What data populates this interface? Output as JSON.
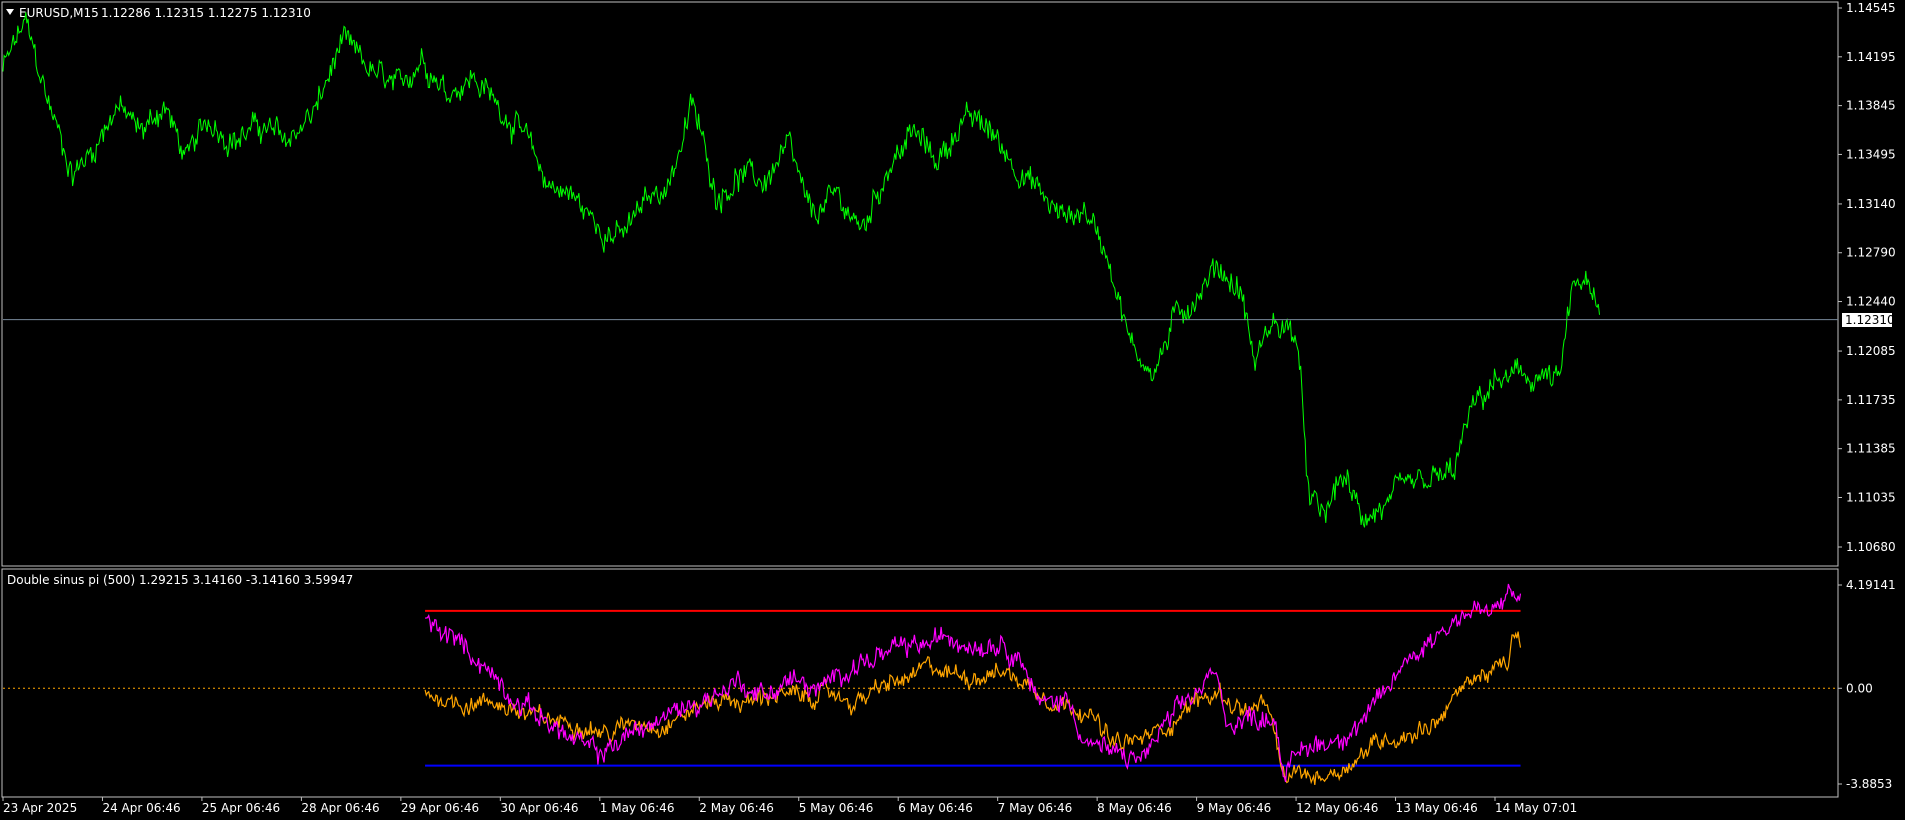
{
  "colors": {
    "background": "#000000",
    "frame": "#c0c0c0",
    "price_line": "#00ff00",
    "bid_line": "#778899",
    "bid_label_bg": "#ffffff",
    "bid_label_text": "#000000",
    "indicator_magenta": "#ff00ff",
    "indicator_orange": "#ffa500",
    "upper_level": "#ff0000",
    "lower_level": "#0000ff",
    "zero_level": "#ffa500"
  },
  "main_chart": {
    "title": "EURUSD,M15",
    "ohlc": "1.12286 1.12315 1.12275 1.12310",
    "menu_icon": "triangle-down-icon",
    "bid_price": "1.12310",
    "price_labels": [
      "1.14545",
      "1.14195",
      "1.13845",
      "1.13495",
      "1.13140",
      "1.12790",
      "1.12440",
      "1.12085",
      "1.11735",
      "1.11385",
      "1.11035",
      "1.10680"
    ],
    "price_anchors": [
      {
        "t": 0,
        "v": 1.141
      },
      {
        "t": 0.012,
        "v": 1.1445
      },
      {
        "t": 0.024,
        "v": 1.139
      },
      {
        "t": 0.038,
        "v": 1.1335
      },
      {
        "t": 0.05,
        "v": 1.1355
      },
      {
        "t": 0.062,
        "v": 1.1385
      },
      {
        "t": 0.075,
        "v": 1.1365
      },
      {
        "t": 0.088,
        "v": 1.1385
      },
      {
        "t": 0.1,
        "v": 1.1345
      },
      {
        "t": 0.112,
        "v": 1.1375
      },
      {
        "t": 0.126,
        "v": 1.136
      },
      {
        "t": 0.14,
        "v": 1.137
      },
      {
        "t": 0.155,
        "v": 1.136
      },
      {
        "t": 0.17,
        "v": 1.138
      },
      {
        "t": 0.185,
        "v": 1.143
      },
      {
        "t": 0.2,
        "v": 1.141
      },
      {
        "t": 0.215,
        "v": 1.1395
      },
      {
        "t": 0.228,
        "v": 1.142
      },
      {
        "t": 0.242,
        "v": 1.1395
      },
      {
        "t": 0.256,
        "v": 1.1405
      },
      {
        "t": 0.27,
        "v": 1.1385
      },
      {
        "t": 0.283,
        "v": 1.1365
      },
      {
        "t": 0.296,
        "v": 1.133
      },
      {
        "t": 0.31,
        "v": 1.132
      },
      {
        "t": 0.323,
        "v": 1.13
      },
      {
        "t": 0.337,
        "v": 1.129
      },
      {
        "t": 0.35,
        "v": 1.1315
      },
      {
        "t": 0.363,
        "v": 1.133
      },
      {
        "t": 0.376,
        "v": 1.1385
      },
      {
        "t": 0.389,
        "v": 1.132
      },
      {
        "t": 0.402,
        "v": 1.1335
      },
      {
        "t": 0.415,
        "v": 1.133
      },
      {
        "t": 0.428,
        "v": 1.1355
      },
      {
        "t": 0.44,
        "v": 1.1305
      },
      {
        "t": 0.455,
        "v": 1.132
      },
      {
        "t": 0.468,
        "v": 1.1295
      },
      {
        "t": 0.482,
        "v": 1.134
      },
      {
        "t": 0.496,
        "v": 1.1365
      },
      {
        "t": 0.51,
        "v": 1.1345
      },
      {
        "t": 0.523,
        "v": 1.1375
      },
      {
        "t": 0.536,
        "v": 1.137
      },
      {
        "t": 0.55,
        "v": 1.1345
      },
      {
        "t": 0.563,
        "v": 1.1325
      },
      {
        "t": 0.576,
        "v": 1.1305
      },
      {
        "t": 0.59,
        "v": 1.131
      },
      {
        "t": 0.603,
        "v": 1.1275
      },
      {
        "t": 0.615,
        "v": 1.121
      },
      {
        "t": 0.628,
        "v": 1.1195
      },
      {
        "t": 0.64,
        "v": 1.1235
      },
      {
        "t": 0.652,
        "v": 1.125
      },
      {
        "t": 0.662,
        "v": 1.127
      },
      {
        "t": 0.675,
        "v": 1.125
      },
      {
        "t": 0.682,
        "v": 1.12
      },
      {
        "t": 0.692,
        "v": 1.123
      },
      {
        "t": 0.705,
        "v": 1.122
      },
      {
        "t": 0.712,
        "v": 1.11
      },
      {
        "t": 0.72,
        "v": 1.109
      },
      {
        "t": 0.73,
        "v": 1.112
      },
      {
        "t": 0.74,
        "v": 1.109
      },
      {
        "t": 0.752,
        "v": 1.1095
      },
      {
        "t": 0.765,
        "v": 1.111
      },
      {
        "t": 0.778,
        "v": 1.1115
      },
      {
        "t": 0.79,
        "v": 1.112
      },
      {
        "t": 0.8,
        "v": 1.1165
      },
      {
        "t": 0.812,
        "v": 1.1185
      },
      {
        "t": 0.826,
        "v": 1.119
      },
      {
        "t": 0.84,
        "v": 1.119
      },
      {
        "t": 0.848,
        "v": 1.1185
      },
      {
        "t": 0.855,
        "v": 1.125
      },
      {
        "t": 0.862,
        "v": 1.126
      },
      {
        "t": 0.87,
        "v": 1.1231
      }
    ]
  },
  "indicator": {
    "title": "Double sinus pi (500) 1.29215 3.14160 -3.14160 3.59947",
    "labels": [
      "4.19141",
      "0.00",
      "-3.8853"
    ],
    "magenta_anchors": [
      {
        "t": 0.23,
        "v": 2.7
      },
      {
        "t": 0.25,
        "v": 1.8
      },
      {
        "t": 0.265,
        "v": 0.7
      },
      {
        "t": 0.28,
        "v": -0.5
      },
      {
        "t": 0.295,
        "v": -1.2
      },
      {
        "t": 0.31,
        "v": -2.1
      },
      {
        "t": 0.325,
        "v": -2.7
      },
      {
        "t": 0.34,
        "v": -1.9
      },
      {
        "t": 0.355,
        "v": -1.4
      },
      {
        "t": 0.37,
        "v": -0.8
      },
      {
        "t": 0.385,
        "v": -0.4
      },
      {
        "t": 0.4,
        "v": 0.3
      },
      {
        "t": 0.415,
        "v": -0.3
      },
      {
        "t": 0.43,
        "v": 0.4
      },
      {
        "t": 0.445,
        "v": -0.2
      },
      {
        "t": 0.46,
        "v": 0.9
      },
      {
        "t": 0.475,
        "v": 1.2
      },
      {
        "t": 0.49,
        "v": 1.6
      },
      {
        "t": 0.505,
        "v": 1.8
      },
      {
        "t": 0.515,
        "v": 2.1
      },
      {
        "t": 0.53,
        "v": 1.8
      },
      {
        "t": 0.545,
        "v": 1.9
      },
      {
        "t": 0.555,
        "v": 1.2
      },
      {
        "t": 0.565,
        "v": -0.7
      },
      {
        "t": 0.58,
        "v": -0.4
      },
      {
        "t": 0.59,
        "v": -2.1
      },
      {
        "t": 0.605,
        "v": -2.7
      },
      {
        "t": 0.62,
        "v": -2.9
      },
      {
        "t": 0.635,
        "v": -1.4
      },
      {
        "t": 0.65,
        "v": -0.2
      },
      {
        "t": 0.66,
        "v": 0.6
      },
      {
        "t": 0.668,
        "v": -1.4
      },
      {
        "t": 0.68,
        "v": -1.2
      },
      {
        "t": 0.693,
        "v": -1.1
      },
      {
        "t": 0.698,
        "v": -3.4
      },
      {
        "t": 0.71,
        "v": -2.4
      },
      {
        "t": 0.725,
        "v": -2.1
      },
      {
        "t": 0.74,
        "v": -1.4
      },
      {
        "t": 0.752,
        "v": -0.4
      },
      {
        "t": 0.765,
        "v": 1.2
      },
      {
        "t": 0.78,
        "v": 2.1
      },
      {
        "t": 0.792,
        "v": 2.9
      },
      {
        "t": 0.805,
        "v": 3.2
      },
      {
        "t": 0.812,
        "v": 2.9
      },
      {
        "t": 0.82,
        "v": 3.9
      },
      {
        "t": 0.827,
        "v": 3.6
      }
    ],
    "orange_anchors": [
      {
        "t": 0.23,
        "v": -0.2
      },
      {
        "t": 0.25,
        "v": -0.6
      },
      {
        "t": 0.27,
        "v": -0.6
      },
      {
        "t": 0.285,
        "v": -1.1
      },
      {
        "t": 0.3,
        "v": -1.3
      },
      {
        "t": 0.315,
        "v": -1.4
      },
      {
        "t": 0.33,
        "v": -1.9
      },
      {
        "t": 0.345,
        "v": -1.3
      },
      {
        "t": 0.36,
        "v": -1.5
      },
      {
        "t": 0.375,
        "v": -0.9
      },
      {
        "t": 0.39,
        "v": -0.4
      },
      {
        "t": 0.405,
        "v": -0.6
      },
      {
        "t": 0.42,
        "v": -0.2
      },
      {
        "t": 0.435,
        "v": -0.4
      },
      {
        "t": 0.45,
        "v": -0.2
      },
      {
        "t": 0.465,
        "v": -0.6
      },
      {
        "t": 0.48,
        "v": 0.1
      },
      {
        "t": 0.495,
        "v": 0.4
      },
      {
        "t": 0.505,
        "v": 0.9
      },
      {
        "t": 0.515,
        "v": 0.6
      },
      {
        "t": 0.53,
        "v": 0.5
      },
      {
        "t": 0.545,
        "v": 0.7
      },
      {
        "t": 0.56,
        "v": 0.1
      },
      {
        "t": 0.575,
        "v": -0.6
      },
      {
        "t": 0.59,
        "v": -0.8
      },
      {
        "t": 0.605,
        "v": -2.3
      },
      {
        "t": 0.62,
        "v": -2.1
      },
      {
        "t": 0.635,
        "v": -1.5
      },
      {
        "t": 0.65,
        "v": -0.5
      },
      {
        "t": 0.663,
        "v": -0.2
      },
      {
        "t": 0.675,
        "v": -0.9
      },
      {
        "t": 0.69,
        "v": -0.8
      },
      {
        "t": 0.698,
        "v": -3.8
      },
      {
        "t": 0.705,
        "v": -3.4
      },
      {
        "t": 0.715,
        "v": -3.6
      },
      {
        "t": 0.725,
        "v": -3.4
      },
      {
        "t": 0.735,
        "v": -3.0
      },
      {
        "t": 0.75,
        "v": -2.1
      },
      {
        "t": 0.765,
        "v": -1.9
      },
      {
        "t": 0.78,
        "v": -1.4
      },
      {
        "t": 0.79,
        "v": -0.5
      },
      {
        "t": 0.8,
        "v": 0.4
      },
      {
        "t": 0.812,
        "v": 0.7
      },
      {
        "t": 0.82,
        "v": 0.9
      },
      {
        "t": 0.823,
        "v": 2.3
      },
      {
        "t": 0.827,
        "v": 1.7
      }
    ]
  },
  "time_labels": [
    "23 Apr 2025",
    "24 Apr 06:46",
    "25 Apr 06:46",
    "28 Apr 06:46",
    "29 Apr 06:46",
    "30 Apr 06:46",
    "1 May 06:46",
    "2 May 06:46",
    "5 May 06:46",
    "6 May 06:46",
    "7 May 06:46",
    "8 May 06:46",
    "9 May 06:46",
    "12 May 06:46",
    "13 May 06:46",
    "14 May 07:01"
  ]
}
